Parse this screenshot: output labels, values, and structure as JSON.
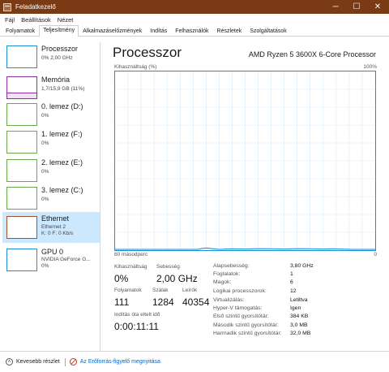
{
  "window": {
    "title": "Feladatkezelő",
    "min": "─",
    "max": "☐",
    "close": "✕"
  },
  "menu": [
    "Fájl",
    "Beállítások",
    "Nézet"
  ],
  "tabs": [
    "Folyamatok",
    "Teljesítmény",
    "Alkalmazáselőzmények",
    "Indítás",
    "Felhasználók",
    "Részletek",
    "Szolgáltatások"
  ],
  "sidebar": [
    {
      "name": "Processzor",
      "sub1": "0% 2,00 GHz",
      "sub2": "",
      "color": "#1b8fd6"
    },
    {
      "name": "Memória",
      "sub1": "1,7/15,9 GB (11%)",
      "sub2": "",
      "color": "#8b2fa0"
    },
    {
      "name": "0. lemez (D:)",
      "sub1": "0%",
      "sub2": "",
      "color": "#6aa84f"
    },
    {
      "name": "1. lemez (F:)",
      "sub1": "0%",
      "sub2": "",
      "color": "#6aa84f"
    },
    {
      "name": "2. lemez (E:)",
      "sub1": "0%",
      "sub2": "",
      "color": "#6aa84f"
    },
    {
      "name": "3. lemez (C:)",
      "sub1": "0%",
      "sub2": "",
      "color": "#6aa84f"
    },
    {
      "name": "Ethernet",
      "sub1": "Ethernet 2",
      "sub2": "K: 0 F: 0 Kb/s",
      "color": "#a0522d"
    },
    {
      "name": "GPU 0",
      "sub1": "NVIDIA GeForce G...",
      "sub2": "0%",
      "color": "#1b8fd6"
    }
  ],
  "main": {
    "title": "Processzor",
    "model": "AMD Ryzen 5 3600X 6-Core Processor",
    "util_label": "Kihasználtság (%)",
    "util_max": "100%",
    "time_label": "60 másodperc",
    "zero_label": "0"
  },
  "stats": {
    "util_label": "Kihasználtság",
    "util_value": "0%",
    "speed_label": "Sebesség",
    "speed_value": "2,00 GHz",
    "proc_label": "Folyamatok",
    "proc_value": "111",
    "threads_label": "Szálak",
    "threads_value": "1284",
    "handles_label": "Leírók",
    "handles_value": "40354",
    "uptime_label": "Indítás óta eltelt idő",
    "uptime_value": "0:00:11:11"
  },
  "specs": [
    {
      "k": "Alapsebesség:",
      "v": "3,80 GHz"
    },
    {
      "k": "Foglalatok:",
      "v": "1"
    },
    {
      "k": "Magok:",
      "v": "6"
    },
    {
      "k": "Logikai processzorok:",
      "v": "12"
    },
    {
      "k": "Virtualizálás:",
      "v": "Letiltva"
    },
    {
      "k": "Hyper-V támogatás:",
      "v": "Igen"
    },
    {
      "k": "Első szintű gyorsítótár:",
      "v": "384 KB"
    },
    {
      "k": "Második szintű gyorsítótár:",
      "v": "3,0 MB"
    },
    {
      "k": "Harmadik szintű gyorsítótár:",
      "v": "32,0 MB"
    }
  ],
  "footer": {
    "less": "Kevesebb részlet",
    "link": "Az Erőforrás-figyelő megnyitása"
  },
  "chart_data": {
    "type": "line",
    "title": "",
    "xlabel": "60 másodperc",
    "ylabel": "Kihasználtság (%)",
    "ylim": [
      0,
      100
    ],
    "x": [
      60,
      57,
      55,
      53,
      51,
      49,
      47,
      45,
      43,
      41,
      40,
      39,
      36,
      33,
      30,
      27,
      24,
      21,
      18,
      15,
      12,
      10,
      8,
      5,
      2,
      0
    ],
    "series": [
      {
        "values": [
          0,
          0,
          0,
          0,
          0,
          0,
          0,
          0,
          0,
          0,
          0.5,
          0.8,
          0,
          0.3,
          0.2,
          0.4,
          0.3,
          0.2,
          0.4,
          0.3,
          0.2,
          0.3,
          0.2,
          0,
          0,
          0
        ]
      }
    ],
    "grid": true,
    "colors": {
      "line": "#1b8fd6",
      "grid": "#d9ecf8"
    }
  }
}
